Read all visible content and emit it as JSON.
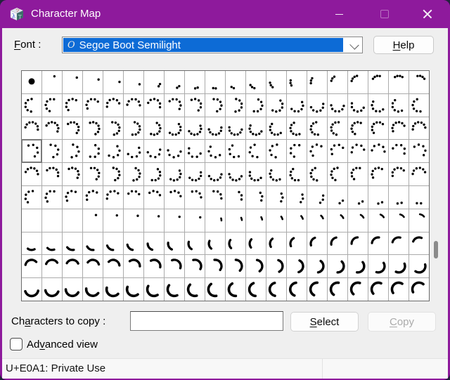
{
  "window": {
    "title": "Character Map",
    "controls": [
      {
        "name": "minimize-button",
        "icon": "minimize-icon"
      },
      {
        "name": "maximize-button",
        "icon": "maximize-icon",
        "enabled": false
      },
      {
        "name": "close-button",
        "icon": "close-icon"
      }
    ]
  },
  "colors": {
    "titlebar": "#8e1a9c",
    "window_border": "#8e1a9c",
    "client_bg": "#efefef",
    "selection_blue": "#0d6bd6",
    "grid_line": "#ababab",
    "disabled_text": "#ababab",
    "desktop_corner": "#23233d"
  },
  "font_row": {
    "label_mn": "F",
    "label_post": "ont :",
    "font_icon": "opentype-font-icon",
    "font_name": "Segoe Boot Semilight",
    "help_mn": "H",
    "help_post": "elp"
  },
  "grid": {
    "columns": 20,
    "rows": 10,
    "selected": {
      "row": 3,
      "col": 0
    },
    "glyph_color": "#000000",
    "row_specs": [
      {
        "type": "intro-dots",
        "big_dot_radius": 4.5,
        "lead0": 270,
        "step": 22,
        "spacing": 24,
        "radius": 9,
        "dot_radius": 1.7
      },
      {
        "type": "dots",
        "count": 6,
        "lead0": 270,
        "step": 18,
        "spacing": 35,
        "radius": 9,
        "dot_radius": 1.7
      },
      {
        "type": "dots",
        "count": 7,
        "lead0": 10,
        "step": 18,
        "spacing": 30,
        "radius": 9,
        "dot_radius": 1.7
      },
      {
        "type": "dots",
        "count": 5,
        "lead0": 60,
        "step": 18,
        "spacing": 45,
        "radius": 9,
        "dot_radius": 1.7
      },
      {
        "type": "dots",
        "count": 6,
        "lead0": 0,
        "step": 18,
        "spacing": 32,
        "radius": 9,
        "dot_radius": 1.7
      },
      {
        "type": "dots-fade",
        "count0": 5,
        "drop_every": 5,
        "lead0": 280,
        "step": 10,
        "spacing": 38,
        "radius": 9,
        "dot_radius": 1.7
      },
      {
        "type": "tick",
        "empty_until": 3,
        "dots_until": 9,
        "dot_angle0": 300,
        "dot_step": 6,
        "arc_center0": 350,
        "arc_center_step": -5,
        "sweep0": 20,
        "sweep_step": 2.5,
        "radius": 9,
        "stroke": 2.6,
        "dot_radius": 1.7
      },
      {
        "type": "arc",
        "center0": 95,
        "center_step": 8,
        "sweep0": 65,
        "sweep_step": 1.5,
        "radius": 9,
        "stroke": 3.2
      },
      {
        "type": "arc",
        "center0": 255,
        "center_step": 8.4,
        "sweep0": 125,
        "sweep_step": 0.8,
        "radius": 9,
        "stroke": 3.4
      },
      {
        "type": "arc",
        "center0": 448,
        "center_step": 7.6,
        "sweep0": 150,
        "sweep_step": 0.3,
        "radius": 9.5,
        "stroke": 3.6
      }
    ]
  },
  "copy_row": {
    "label_pre": "Ch",
    "label_mn": "a",
    "label_post": "racters to copy :",
    "input_value": "",
    "select_mn": "S",
    "select_post": "elect",
    "copy_mn": "C",
    "copy_post": "opy",
    "copy_enabled": false
  },
  "advanced_view": {
    "label_pre": "Ad",
    "label_mn": "v",
    "label_post": "anced view",
    "checked": false
  },
  "status_bar": {
    "text": "U+E0A1: Private Use"
  }
}
